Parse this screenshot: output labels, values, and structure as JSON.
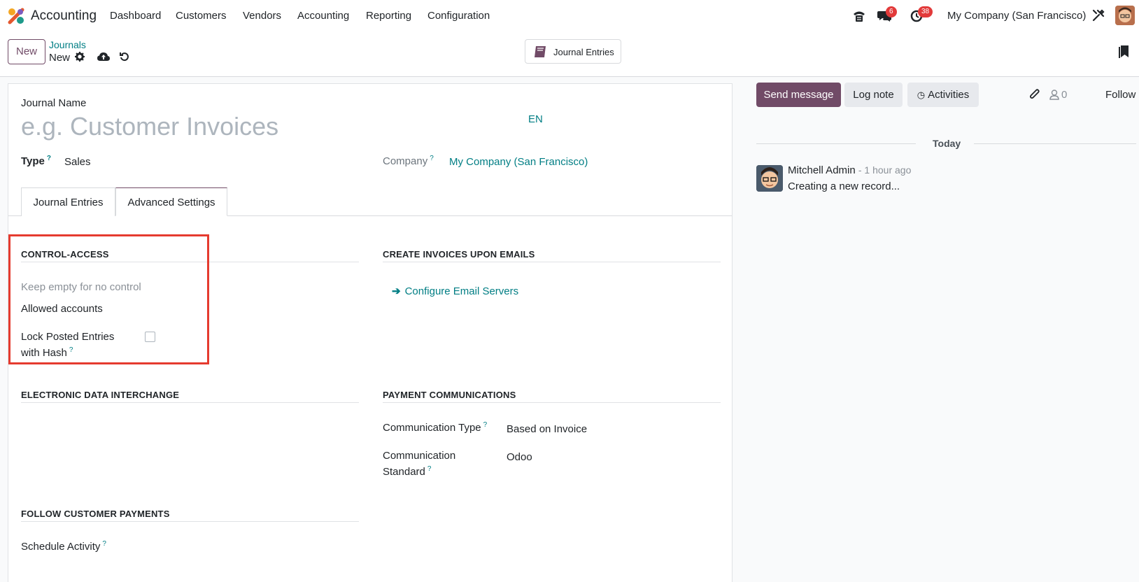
{
  "topnav": {
    "app_name": "Accounting",
    "menu": [
      "Dashboard",
      "Customers",
      "Vendors",
      "Accounting",
      "Reporting",
      "Configuration"
    ],
    "messages_count": "6",
    "activities_count": "38",
    "company": "My Company (San Francisco)"
  },
  "controlbar": {
    "new_label": "New",
    "breadcrumb_parent": "Journals",
    "breadcrumb_current": "New",
    "smart_button_label": "Journal Entries"
  },
  "form": {
    "journal_name_label": "Journal Name",
    "journal_name_placeholder": "e.g. Customer Invoices",
    "lang": "EN",
    "type_label": "Type",
    "type_value": "Sales",
    "company_label": "Company",
    "company_value": "My Company (San Francisco)",
    "help_mark": "?",
    "tabs": [
      "Journal Entries",
      "Advanced Settings"
    ],
    "control_access": {
      "title": "CONTROL-ACCESS",
      "hint": "Keep empty for no control",
      "allowed_accounts": "Allowed accounts",
      "lock_label_1": "Lock Posted Entries",
      "lock_label_2": "with Hash"
    },
    "create_invoices": {
      "title": "CREATE INVOICES UPON EMAILS",
      "link": "Configure Email Servers"
    },
    "edi": {
      "title": "ELECTRONIC DATA INTERCHANGE"
    },
    "payment_comm": {
      "title": "PAYMENT COMMUNICATIONS",
      "type_label": "Communication Type",
      "type_value": "Based on Invoice",
      "standard_label_1": "Communication",
      "standard_label_2": "Standard",
      "standard_value": "Odoo"
    },
    "follow_payments": {
      "title": "FOLLOW CUSTOMER PAYMENTS",
      "schedule_label": "Schedule Activity"
    }
  },
  "chatter": {
    "send_message": "Send message",
    "log_note": "Log note",
    "activities": "Activities",
    "followers_count": "0",
    "follow": "Follow",
    "today": "Today",
    "author": "Mitchell Admin",
    "time": "- 1 hour ago",
    "message": "Creating a new record..."
  },
  "colors": {
    "brand": "#714b67",
    "link": "#017e84",
    "highlight": "#e53b2f"
  }
}
